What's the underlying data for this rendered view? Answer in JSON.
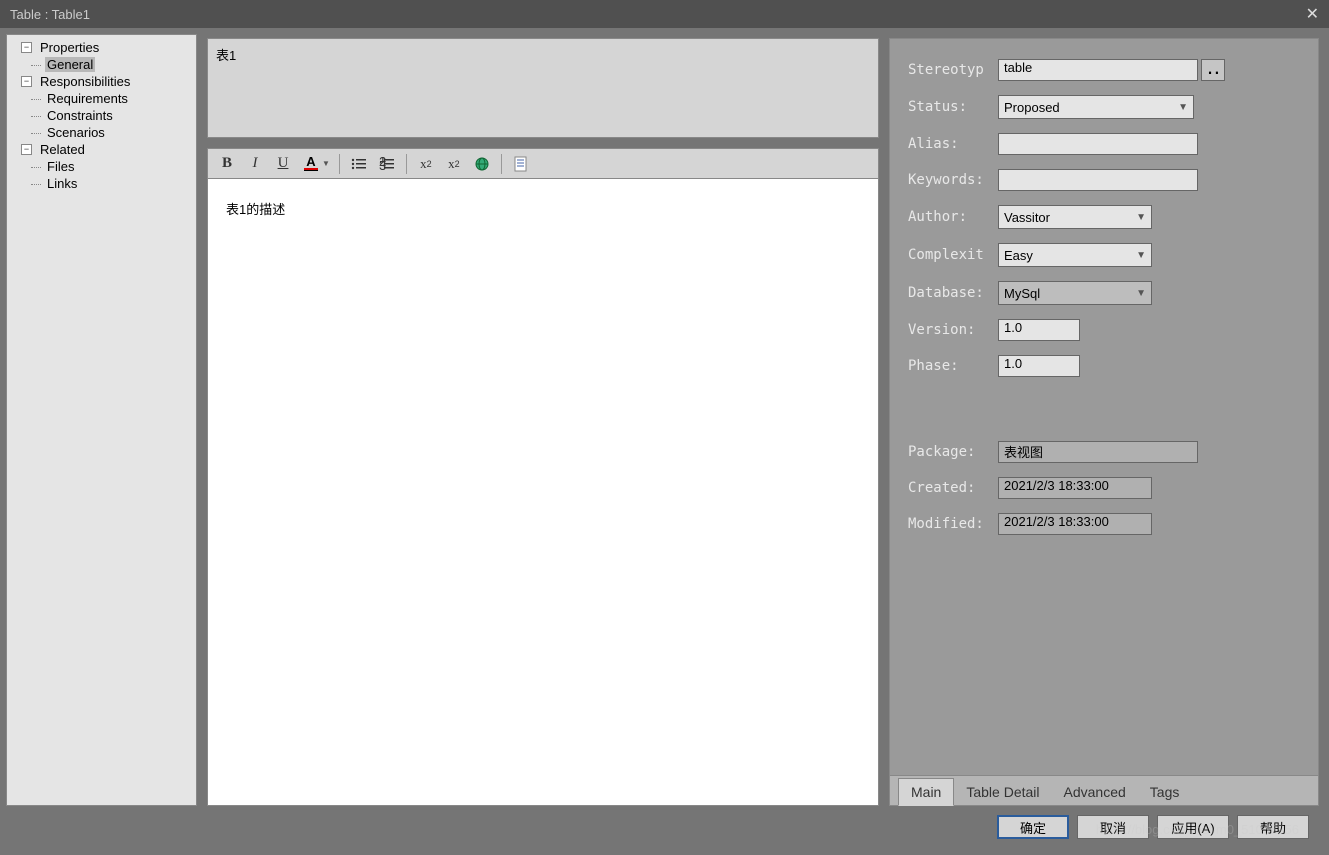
{
  "window": {
    "title": "Table : Table1"
  },
  "sidebar": {
    "properties": {
      "label": "Properties",
      "general": "General"
    },
    "responsibilities": {
      "label": "Responsibilities",
      "requirements": "Requirements",
      "constraints": "Constraints",
      "scenarios": "Scenarios"
    },
    "related": {
      "label": "Related",
      "files": "Files",
      "links": "Links"
    }
  },
  "editor": {
    "name_value": "表1",
    "description_value": "表1的描述"
  },
  "toolbar_icons": {
    "bold": "B",
    "italic": "I",
    "underline": "U",
    "color": "A",
    "bullets": "≡",
    "numbers": "≡",
    "super": "x²",
    "sub": "x₂",
    "link": "🔗",
    "new": "📄"
  },
  "props": {
    "stereotype": {
      "label": "Stereotyp",
      "value": "table"
    },
    "status": {
      "label": "Status:",
      "value": "Proposed"
    },
    "alias": {
      "label": "Alias:",
      "value": ""
    },
    "keywords": {
      "label": "Keywords:",
      "value": ""
    },
    "author": {
      "label": "Author:",
      "value": "Vassitor"
    },
    "complexity": {
      "label": "Complexit",
      "value": "Easy"
    },
    "database": {
      "label": "Database:",
      "value": "MySql"
    },
    "version": {
      "label": "Version:",
      "value": "1.0"
    },
    "phase": {
      "label": "Phase:",
      "value": "1.0"
    },
    "package": {
      "label": "Package:",
      "value": "表视图"
    },
    "created": {
      "label": "Created:",
      "value": "2021/2/3 18:33:00"
    },
    "modified": {
      "label": "Modified:",
      "value": "2021/2/3 18:33:00"
    }
  },
  "tabs": {
    "main": "Main",
    "detail": "Table Detail",
    "advanced": "Advanced",
    "tags": "Tags"
  },
  "footer": {
    "ok": "确定",
    "cancel": "取消",
    "apply": "应用(A)",
    "help": "帮助"
  },
  "watermark": "https://blog.csdn.net/m0_51038256"
}
